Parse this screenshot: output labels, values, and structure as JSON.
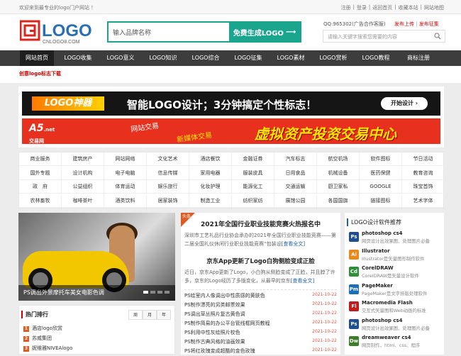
{
  "topbar": {
    "welcome": "欢迎来到最专业的logo门户网站 ！",
    "links": [
      "注册",
      "|",
      "登录",
      "|",
      "返回首页",
      "|",
      "收藏本站",
      "|",
      "网站地图"
    ]
  },
  "header": {
    "logo_text": "LOGO",
    "logo_sub": "CNLOGO8.COM",
    "search_placeholder": "输入品牌名称",
    "search_button": "免费生成LOGO",
    "qq": "QQ:965302(广告合作客服)",
    "publish": "发布上传",
    "collect": "发布征集",
    "site_search": "请输入关键字搜索您需要的内容"
  },
  "nav": [
    "网站首页",
    "LOGO收集",
    "LOGO意义",
    "LOGO知识",
    "LOGO综合",
    "LOGO征集",
    "LOGO素材",
    "LOGO赏析",
    "LOGO教程",
    "商标注册"
  ],
  "subnav": "创意logo标志下载",
  "banner1": {
    "brand": "LOGO神器",
    "slogan": "智能LOGO设计；3分钟搞定个性标志！",
    "button": "开始设计"
  },
  "banner2": {
    "brand": "A5",
    "brand_sub": ".net",
    "brand_cn": "交易网",
    "t1": "网站交易",
    "t2": "新媒体交易",
    "big": "虚拟资产投资交易中心"
  },
  "categories": [
    [
      "商业服务",
      "建筑房产",
      "网站网络",
      "文化艺术",
      "酒店餐饮",
      "金融证券",
      "汽车标志",
      "航空机场",
      "软件图标",
      "节日活动"
    ],
    [
      "国外专题",
      "设计机构",
      "电子电脑",
      "信息传媒",
      "家用电器",
      "服装皮具",
      "日用食品",
      "机械设备",
      "医药保健",
      "教育咨询"
    ],
    [
      "政　府",
      "公益组织",
      "体育运动",
      "娱乐旅行",
      "化妆护理",
      "能源化工",
      "交通运输",
      "厨卫家私",
      "GOOGLE",
      "珠宝首饰"
    ],
    [
      "农林畜牧",
      "咖啡茶叶",
      "酒类饮料",
      "居家装饰",
      "制造工业",
      "纺织家纺",
      "展馆公园",
      "各国国旗",
      "链接图标",
      "艺术字体"
    ]
  ],
  "slider": {
    "caption": "PS调出外景摩托车美女电影色调"
  },
  "hot": {
    "title": "热门排行",
    "tabs": [
      "周",
      "月",
      "年"
    ],
    "items": [
      "酒店logo欣赏",
      "苏威集团",
      "妮维雅NIVEAlogo"
    ]
  },
  "mid": {
    "corner": "头条",
    "title1": "2021年全国行业职业技能竞赛火热报名中",
    "text1": "深圳市工艺礼品行业协会承办的2021年全国行业职业技能竞赛——第二届全国礼仪休闲行业职业技能竞赛“包装设",
    "more1": "[查看全文]",
    "title2": "京东App更新了Logo白狗侧脸变成正脸",
    "text2": "近日，京东App更新了Logo，小白狗从侧脸变成了正脸，并且脖了许多，京东的Logo经历了多版变化，从最早的京东",
    "more2": "[查看全文]",
    "news": [
      {
        "title": "PS绘室内人像调出中性质感的黄肤色",
        "date": "2021-10-22"
      },
      {
        "title": "PS制作漂亮的另类邮票效果",
        "date": "2021-10-22"
      },
      {
        "title": "PS调出草丛照片复古黄色调",
        "date": "2021-10-22"
      },
      {
        "title": "PS制作简易的办公平台管线框网页教程",
        "date": "2021-10-22"
      },
      {
        "title": "PS利用中性灰绘照片校色",
        "date": "2021-10-22"
      },
      {
        "title": "PS制作古典风格的油画效果",
        "date": "2021-10-22"
      },
      {
        "title": "PS将红玫瑰变成超酷的金色玫瑰",
        "date": "2021-10-22"
      }
    ]
  },
  "software": {
    "title": "LOGO设计软件推荐",
    "items": [
      {
        "name": "photoshop cs4",
        "desc": "网页设计出效果图、处理图片必备",
        "icon": "Ps",
        "color": "#1d4f91"
      },
      {
        "name": "Illustrator",
        "desc": "Illustrator是矢量图形制作软件",
        "icon": "Ai",
        "color": "#e8891a"
      },
      {
        "name": "CorelDRAW",
        "desc": "CorelDRAW是矢量设计软件",
        "icon": "Cd",
        "color": "#2f8f3a"
      },
      {
        "name": "PageMaker",
        "desc": "PageMaker是文字排版处理软件",
        "icon": "Pm",
        "color": "#1a6fb8"
      },
      {
        "name": "Macromedia Flash",
        "desc": "交互式矢量图和Web动画的标准",
        "icon": "Fl",
        "color": "#c01d1d"
      },
      {
        "name": "photoshop cs4",
        "desc": "网页设计出效果图、处理图片必备",
        "icon": "Ps",
        "color": "#1d4f91"
      },
      {
        "name": "dreamweaver cs4",
        "desc": "网页制作，html、css、程序",
        "icon": "Dw",
        "color": "#3d7d2a"
      }
    ]
  }
}
